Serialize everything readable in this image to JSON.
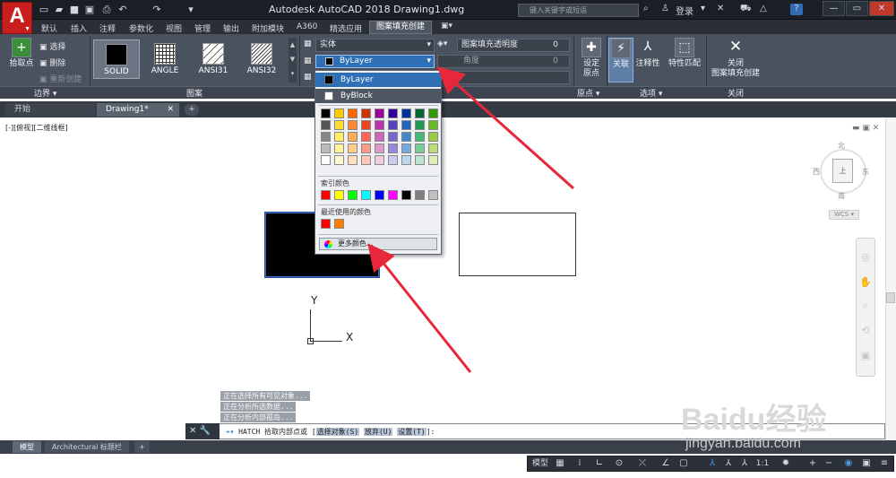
{
  "window": {
    "title": "Autodesk AutoCAD 2018    Drawing1.dwg",
    "app_logo": "A",
    "search_placeholder": "键入关键字或短语",
    "login": "登录",
    "help": "?"
  },
  "ribbon_tabs": [
    "默认",
    "插入",
    "注释",
    "参数化",
    "视图",
    "管理",
    "输出",
    "附加模块",
    "A360",
    "精选应用",
    "图案填充创建"
  ],
  "active_tab": "图案填充创建",
  "boundary_panel": {
    "pick_point": "拾取点",
    "select": "选择",
    "remove": "删除",
    "recreate": "重新创建",
    "label": "边界"
  },
  "pattern_panel": {
    "label": "图案",
    "patterns": [
      "SOLID",
      "ANGLE",
      "ANSI31",
      "ANSI32"
    ]
  },
  "properties_panel": {
    "type_value": "实体",
    "color_value": "ByLayer",
    "transparency_label": "图案填充透明度",
    "transparency_value": "0",
    "angle_label": "角度",
    "angle_value": "0"
  },
  "origin_panel": {
    "set_origin": "设定\n原点",
    "label": "原点"
  },
  "options_panel": {
    "associative": "关联",
    "annotative": "注释性",
    "match": "特性匹配",
    "label": "选项"
  },
  "close_panel": {
    "close": "关闭\n图案填充创建",
    "label": "关闭"
  },
  "file_tabs": [
    "开始",
    "Drawing1*"
  ],
  "view_label": "[-][俯视][二维线框]",
  "color_dropdown": {
    "items": [
      "ByLayer",
      "ByBlock"
    ],
    "index_color_label": "索引颜色",
    "recent_label": "最近使用的颜色",
    "more_colors": "更多颜色...",
    "palette_rows": [
      [
        "#000000",
        "#ffcc00",
        "#ff6600",
        "#cc3300",
        "#990099",
        "#330099",
        "#003399",
        "#006633",
        "#339900"
      ],
      [
        "#555555",
        "#ffdd33",
        "#ff8833",
        "#ee4422",
        "#bb33aa",
        "#5544bb",
        "#2266bb",
        "#229955",
        "#66bb22"
      ],
      [
        "#888888",
        "#ffee66",
        "#ffaa55",
        "#ff6655",
        "#cc66bb",
        "#7766cc",
        "#4488cc",
        "#44bb77",
        "#99cc44"
      ],
      [
        "#bbbbbb",
        "#fff299",
        "#ffcc88",
        "#ff9988",
        "#dd99cc",
        "#9988dd",
        "#77aadd",
        "#77cc99",
        "#bbdd77"
      ],
      [
        "#ffffff",
        "#fff8cc",
        "#ffe0bb",
        "#ffc4bb",
        "#eeccdd",
        "#ccccee",
        "#bbd8ee",
        "#bbe6cc",
        "#ddeebb"
      ]
    ],
    "index_colors": [
      "#ff0000",
      "#ffff00",
      "#00ff00",
      "#00ffff",
      "#0000ff",
      "#ff00ff",
      "#000000",
      "#808080",
      "#c0c0c0"
    ],
    "recent_colors": [
      "#ff0000",
      "#ff8000"
    ]
  },
  "viewcube": {
    "north": "北",
    "south": "南",
    "west": "西",
    "east": "东",
    "face": "上",
    "wcs": "WCS"
  },
  "axis": {
    "y": "Y",
    "x": "X"
  },
  "command_history": [
    "正在选择所有可见对象...",
    "正在分析所选数据...",
    "正在分析内部孤岛..."
  ],
  "command": {
    "prefix": "HATCH 拾取内部点或 [",
    "opt1": "选择对象(S)",
    "opt2": "放弃(U)",
    "opt3": "设置(T)",
    "suffix": "]:"
  },
  "layout_tabs": [
    "模型",
    "Architectural 标题栏",
    "+"
  ],
  "status": {
    "model": "模型",
    "scale": "1:1"
  },
  "watermark": {
    "brand": "Baidu经验",
    "url": "jingyan.baidu.com"
  },
  "colors": {
    "accent": "#2f6fb5",
    "annotation_arrow": "#e8283a"
  }
}
